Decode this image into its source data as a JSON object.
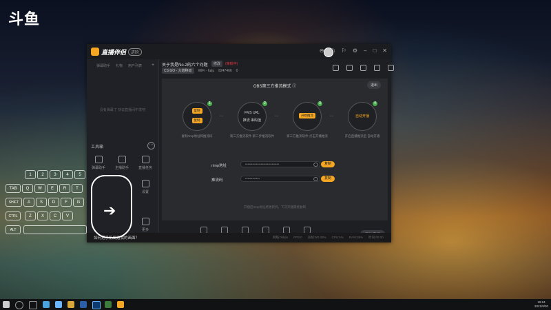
{
  "desktop_logo": "斗鱼",
  "app": {
    "brand": "直播伴侣",
    "brand_badge": "进阶",
    "window_controls": [
      "⊖",
      "☖",
      "⚐",
      "⚙",
      "–",
      "□",
      "✕"
    ]
  },
  "left_panel": {
    "tabs": [
      "弹幕助手",
      "礼物",
      "用户列表"
    ],
    "empty_message": "没有弹幕了 快去直播间中发吧",
    "tools_heading": "工具箱",
    "tools": [
      {
        "label": "弹幕助手"
      },
      {
        "label": "主播助手"
      },
      {
        "label": "直播任务"
      },
      {
        "label": "设置"
      },
      {
        "label": "弹幕"
      },
      {
        "label": "蓝光"
      },
      {
        "label": "更多"
      }
    ]
  },
  "room": {
    "title": "关于我是No.2的六个问题",
    "edit_label": "修改",
    "red_text": "(审核中)",
    "game_tag": "CS:GO - 大炮移动",
    "wifi": "WiFi - fujiu",
    "room_id": "8247466",
    "fans": "0"
  },
  "obs": {
    "title": "OBS第三方推流模式 ⓘ",
    "exit": "退出",
    "steps": [
      {
        "num": "1",
        "inner_top": "复制",
        "inner_bottom": "复制",
        "caption": "复制rtmp地址和推流码"
      },
      {
        "num": "2",
        "inner_top": "FMS URL",
        "inner_bottom": "推流 串码值",
        "caption": "第三方推流软件 第二步推流软件"
      },
      {
        "num": "3",
        "inner_top": "开始推流",
        "inner_bottom": "",
        "caption": "第三方推流软件 点击开播推流"
      },
      {
        "num": "4",
        "inner_top": "自动开播",
        "inner_bottom": "",
        "caption": "开启直播推流后 自动开播"
      }
    ],
    "rtmp_label": "rtmp地址",
    "rtmp_value": "••••••••••••••••••••••••••••",
    "key_label": "推流码",
    "key_value": "••••••••••••",
    "copy_label": "复制",
    "note": "开播后rtmp地址将更新到，下次开播需要复制"
  },
  "bottom_tools": [
    "画面截屏",
    "摄像头",
    "游戏",
    "屏幕",
    "麦克风",
    "扬声器"
  ],
  "start_button": "开始直播",
  "status": {
    "message": "如何把手机发给我的画面？",
    "stats": [
      "网络:0kbps",
      "FPS:0",
      "丢帧:0/0.00%",
      "CPU:5%",
      "RAM:35%",
      "时间:00:00"
    ]
  },
  "keyboard": {
    "keys": [
      "1",
      "2",
      "3",
      "4",
      "5",
      "TAB",
      "Q",
      "W",
      "E",
      "R",
      "T",
      "SHIFT",
      "A",
      "S",
      "D",
      "F",
      "G",
      "CTRL",
      "Z",
      "X",
      "C",
      "V",
      "ALT"
    ]
  },
  "taskbar": {
    "time": "19:24",
    "date": "2021/9/30"
  }
}
